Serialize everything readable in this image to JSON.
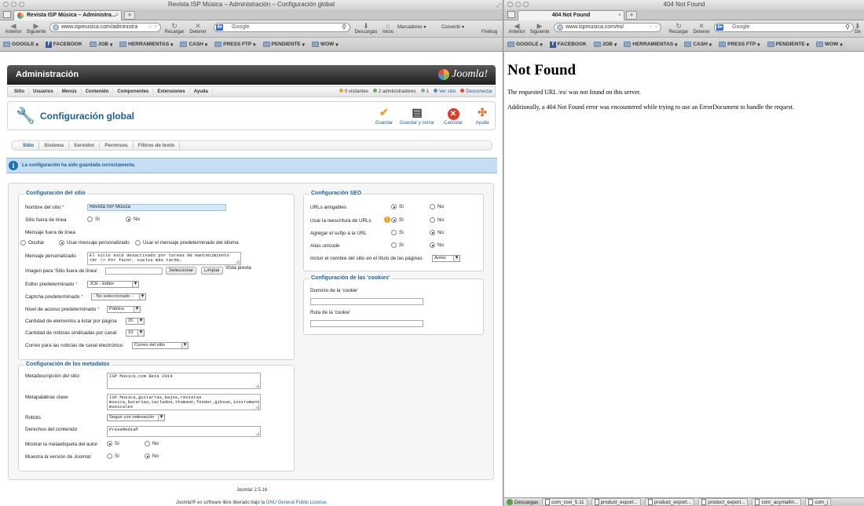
{
  "left": {
    "title": "Revista ISP Música – Administración – Configuración global",
    "tab": "Revista ISP Música – Administra...",
    "nav": {
      "back": "Anterior",
      "forward": "Siguiente",
      "reload": "Recargar",
      "stop": "Detener",
      "downloads": "Descargas",
      "home": "Inicio",
      "bookmarks": "Marcadores",
      "convert": "Convertir",
      "firebug": "Firebug"
    },
    "url": "www.ispmusica.com/administra",
    "search_placeholder": "Google",
    "bookmarks": [
      "GOOGLE",
      "FACEBOOK",
      "JOB",
      "HERRAMIENTAS",
      "CASH",
      "PRESS FTP",
      "PENDIENTE",
      "WOW"
    ],
    "joomla": {
      "header": "Administración",
      "logo": "Joomla!",
      "menu": [
        "Sitio",
        "Usuarios",
        "Menús",
        "Contenido",
        "Componentes",
        "Extensiones",
        "Ayuda"
      ],
      "status": {
        "visitors": "0 visitantes",
        "admins": "2 administradores",
        "messages": "1",
        "view_site": "Ver sitio",
        "logout": "Desconectar"
      },
      "page_title": "Configuración global",
      "toolbar": {
        "save": "Guardar",
        "save_close": "Guardar y cerrar",
        "cancel": "Cancelar",
        "help": "Ayuda"
      },
      "tabs": [
        "Sitio",
        "Sistema",
        "Servidor",
        "Permisos",
        "Filtros de texto"
      ],
      "message": "La configuración ha sido guardada correctamente.",
      "site": {
        "legend": "Configuración del sitio",
        "site_name_label": "Nombre del sitio",
        "site_name": "Revista ISP Música",
        "offline_label": "Sitio fuera de línea",
        "yes": "Sí",
        "no": "No",
        "offline_msg_label": "Mensaje fuera de línea",
        "offline_opts": [
          "Ocultar",
          "Usar mensaje personalizado",
          "Usar el mensaje predeterminado del idioma"
        ],
        "custom_msg_label": "Mensaje personalizado",
        "custom_msg": "El sitio está desactivado por tareas de mantenimiento <br /> Por favor, vuelva más tarde.",
        "offline_image_label": "Imagen para 'Sitio fuera de línea'",
        "select_btn": "Seleccionar",
        "clear_btn": "Limpiar",
        "preview": "Vista previa",
        "editor_label": "Editor predeterminado",
        "editor": "JCE - Editor",
        "captcha_label": "Captcha predeterminado",
        "captcha": "- No seleccionado -",
        "access_label": "Nivel de acceso predeterminado",
        "access": "Público",
        "list_limit_label": "Cantidad de elementos a listar por página",
        "list_limit": "20",
        "feed_limit_label": "Cantidad de noticias sindicadas por canal",
        "feed_limit": "10",
        "feed_email_label": "Correo para las noticias de canal electrónico",
        "feed_email": "Correo del sitio"
      },
      "seo": {
        "legend": "Configuración SEO",
        "sef_label": "URLs amigables",
        "rewrite_label": "Usar la reescritura de URLs",
        "suffix_label": "Agregar el sufijo a la URL",
        "unicode_label": "Alias unicode",
        "sitename_label": "Incluir el nombre del sitio en el título de las páginas",
        "sitename": "Antes"
      },
      "cookies": {
        "legend": "Configuración de las 'cookies'",
        "domain_label": "Dominio de la 'cookie'",
        "path_label": "Ruta de la 'cookie'"
      },
      "meta": {
        "legend": "Configuración de los metadatos",
        "desc_label": "Metadescripción del sitio",
        "desc": "ISP Música.com Beta 2014",
        "keys_label": "Metapalabras clave",
        "keys": "ISP Música,guitarras,bajos,revistas musica,baterias,teclados,thomann,fender,gibson,instrumentos musicales",
        "robots_label": "Robots",
        "robots": "Seguir con indexación",
        "rights_label": "Derechos del contenido",
        "rights": "PresaMedia®",
        "author_label": "Mostrar la metaetiqueta del autor",
        "version_label": "Muestra la versión de Joomla!"
      },
      "footer_version": "Joomla! 2.5.16",
      "footer_pre": "Joomla!® es software libre liberado bajo la ",
      "footer_link": "GNU General Public License."
    }
  },
  "right": {
    "title": "404 Not Found",
    "tab": "404 Not Found",
    "nav": {
      "back": "Anterior",
      "forward": "Siguiente",
      "reload": "Recargar",
      "stop": "Detener",
      "downloads": "De"
    },
    "url": "www.ispmusica.com/es/",
    "search_placeholder": "Google",
    "bookmarks": [
      "GOOGLE",
      "FACEBOOK",
      "JOB",
      "HERRAMIENTAS",
      "CASH",
      "PRESS FTP",
      "PENDIENTE",
      "WOW"
    ],
    "heading": "Not Found",
    "p1": "The requested URL /es/ was not found on this server.",
    "p2": "Additionally, a 404 Not Found error was encountered while trying to use an ErrorDocument to handle the request.",
    "downloads": [
      "Descargas",
      "com_csvi_5.11",
      "product_export...",
      "product_export...",
      "product_export...",
      "com_acymailin...",
      "com_j"
    ]
  }
}
